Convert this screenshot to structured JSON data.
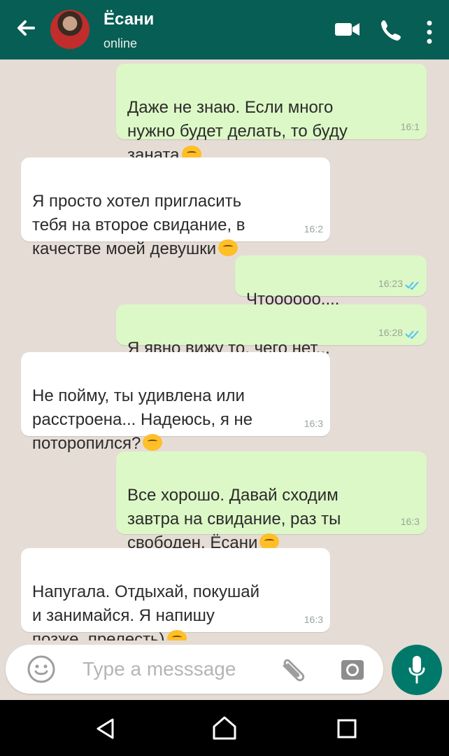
{
  "header": {
    "contact_name": "Ёсани",
    "status": "online",
    "icons": [
      "back-arrow-icon",
      "video-call-icon",
      "phone-call-icon",
      "more-options-icon"
    ]
  },
  "messages": [
    {
      "direction": "out",
      "text": "Даже не знаю. Если много\nнужно будет делать, то буду\nзаната",
      "emoji": "annoyed-face",
      "time": "16:1"
    },
    {
      "direction": "in",
      "text": "Я просто хотел пригласить\nтебя на второе свидание, в\nкачестве моей девушки",
      "emoji": "smiling-face",
      "time": "16:2"
    },
    {
      "direction": "out",
      "text": "Чтоооооо....",
      "time": "16:23",
      "status": "read"
    },
    {
      "direction": "out",
      "text": "Я явно вижу то, чего нет...",
      "time": "16:28",
      "status": "read"
    },
    {
      "direction": "in",
      "text": "Не пойму, ты удивлена или\nрасстроена... Надеюсь, я не\nпоторопился?",
      "emoji": "worried-face",
      "time": "16:3"
    },
    {
      "direction": "out",
      "text": "Все хорошо. Давай сходим\nзавтра на свидание, раз ты\nсвободен, Ёсани",
      "emoji": "smiling-face",
      "time": "16:3"
    },
    {
      "direction": "in",
      "text": "Напугала. Отдыхай, покушай\nи занимайся. Я напишу\nпозже, прелесть)",
      "emoji": "kissing-face",
      "time": "16:3"
    }
  ],
  "composer": {
    "placeholder": "Type a messsage",
    "icons": [
      "emoji-icon",
      "attach-icon",
      "camera-icon",
      "microphone-icon"
    ]
  },
  "nav": {
    "icons": [
      "back-nav-icon",
      "home-nav-icon",
      "recents-nav-icon"
    ]
  },
  "colors": {
    "header": "#075e54",
    "outgoing_bubble": "#dcf8c6",
    "incoming_bubble": "#ffffff",
    "chat_background": "#e5ddd5",
    "mic_button": "#00796b",
    "read_ticks": "#4fc3f7"
  }
}
